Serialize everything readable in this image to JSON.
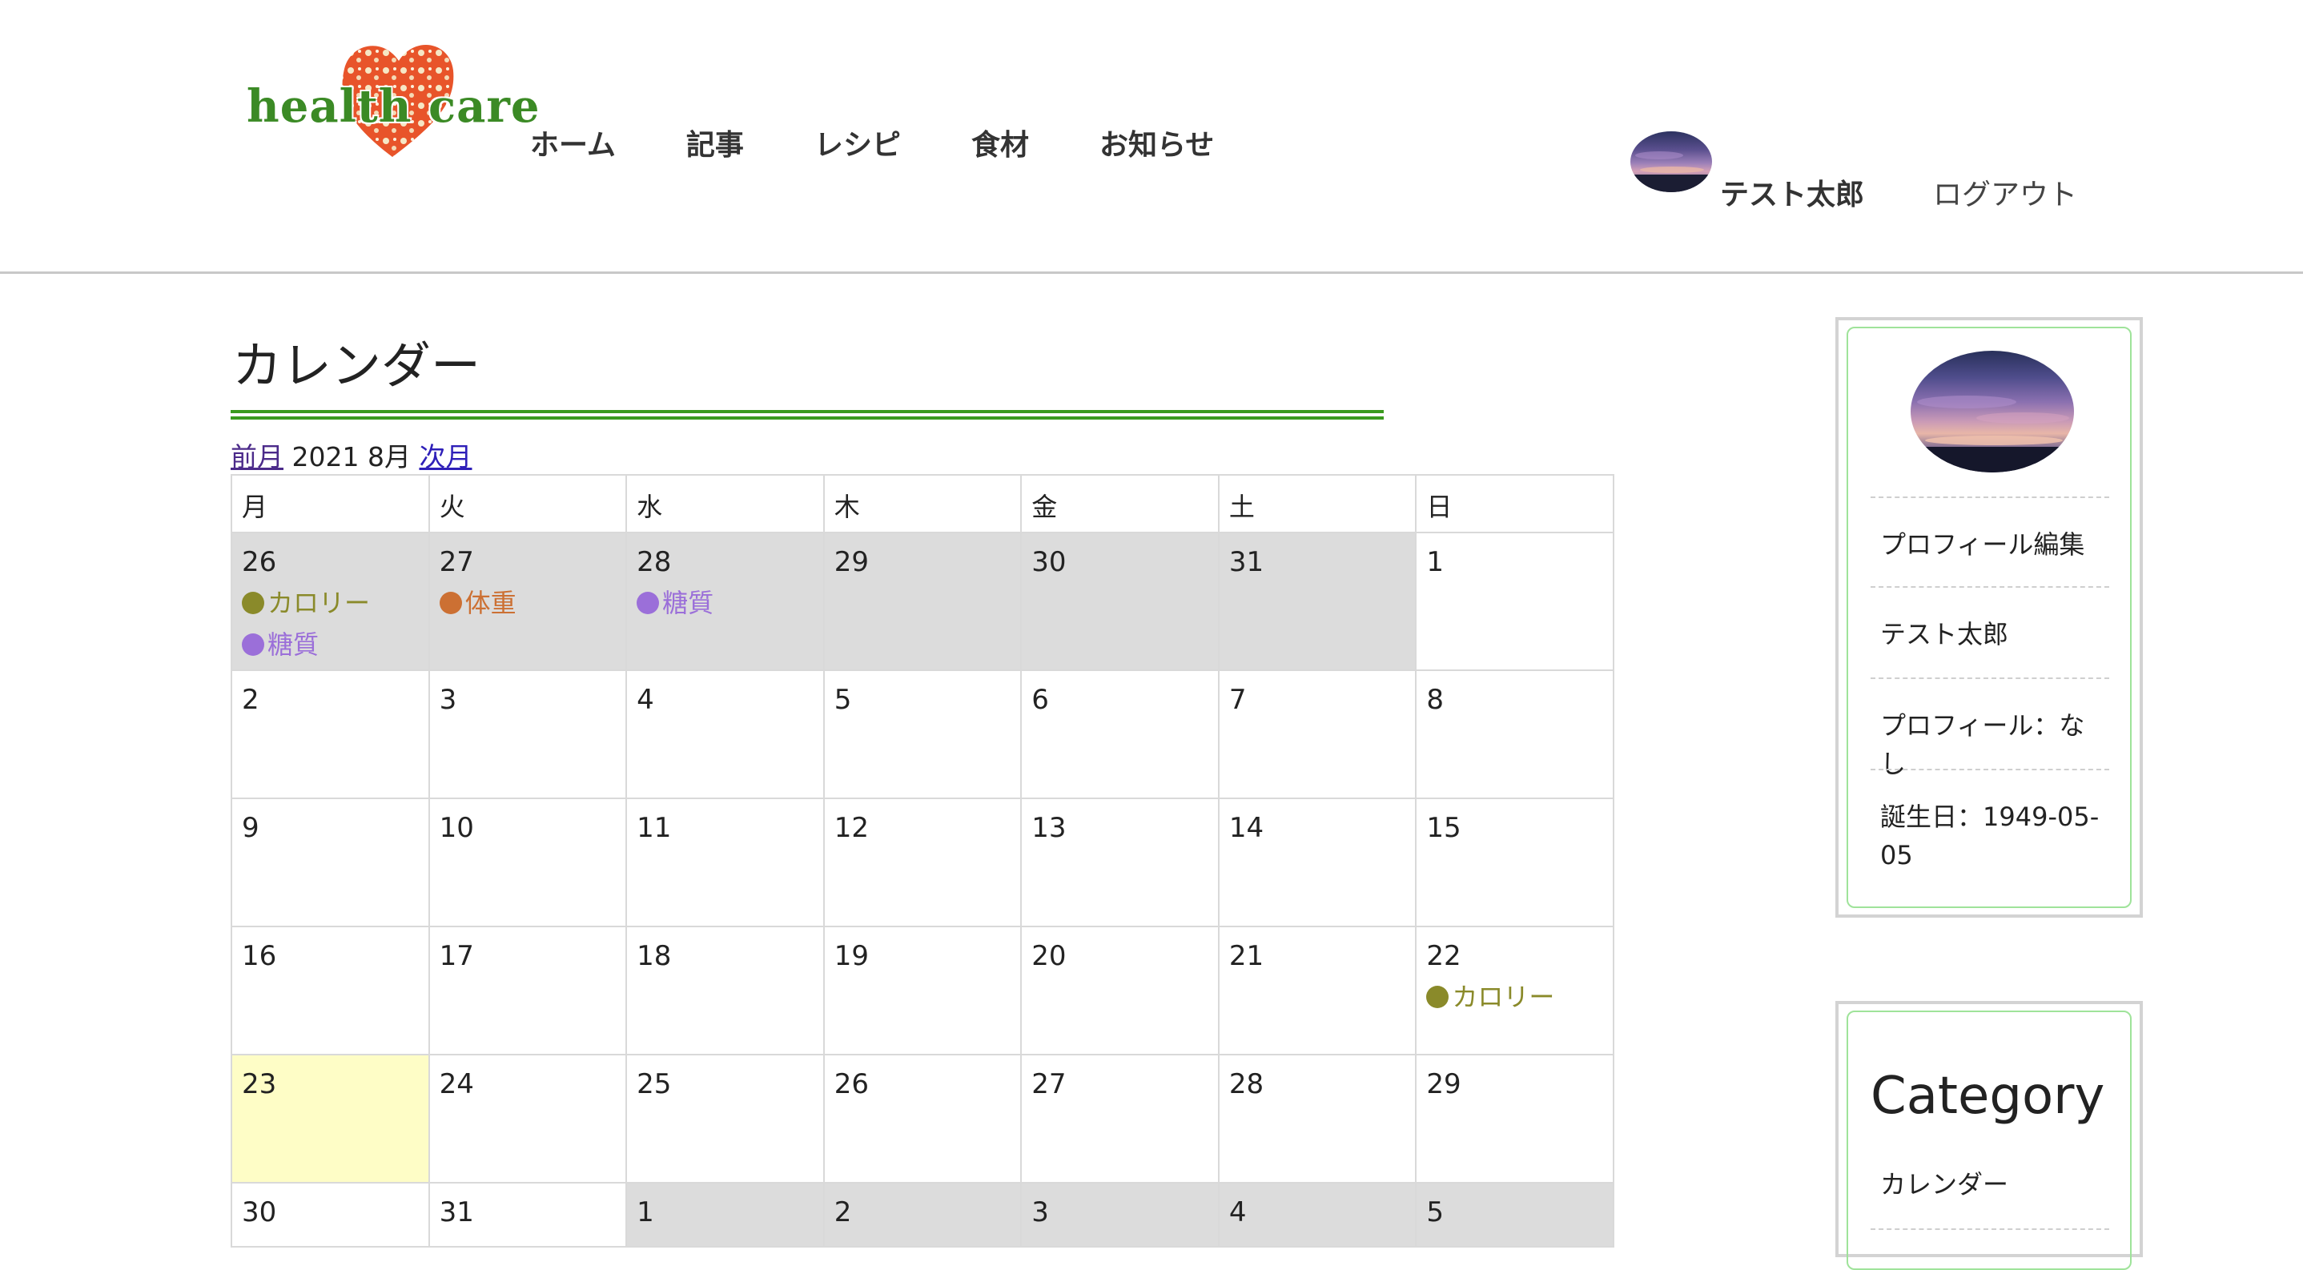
{
  "header": {
    "logo_text": "health care",
    "nav": [
      "ホーム",
      "記事",
      "レシピ",
      "食材",
      "お知らせ"
    ],
    "user_name": "テスト太郎",
    "logout": "ログアウト"
  },
  "main": {
    "title": "カレンダー",
    "prev_label": "前月",
    "current_month": "2021 8月",
    "next_label": "次月",
    "weekdays": [
      "月",
      "火",
      "水",
      "木",
      "金",
      "土",
      "日"
    ],
    "weeks": [
      [
        {
          "day": "26",
          "out": true,
          "events": [
            {
              "label": "カロリー",
              "color": "#8a8a2a"
            },
            {
              "label": "糖質",
              "color": "#9b6fd9"
            }
          ]
        },
        {
          "day": "27",
          "out": true,
          "events": [
            {
              "label": "体重",
              "color": "#cc7033"
            }
          ]
        },
        {
          "day": "28",
          "out": true,
          "events": [
            {
              "label": "糖質",
              "color": "#9b6fd9"
            }
          ]
        },
        {
          "day": "29",
          "out": true,
          "events": []
        },
        {
          "day": "30",
          "out": true,
          "events": []
        },
        {
          "day": "31",
          "out": true,
          "events": []
        },
        {
          "day": "1",
          "out": false,
          "events": []
        }
      ],
      [
        {
          "day": "2",
          "out": false,
          "events": []
        },
        {
          "day": "3",
          "out": false,
          "events": []
        },
        {
          "day": "4",
          "out": false,
          "events": []
        },
        {
          "day": "5",
          "out": false,
          "events": []
        },
        {
          "day": "6",
          "out": false,
          "events": []
        },
        {
          "day": "7",
          "out": false,
          "events": []
        },
        {
          "day": "8",
          "out": false,
          "events": []
        }
      ],
      [
        {
          "day": "9",
          "out": false,
          "events": []
        },
        {
          "day": "10",
          "out": false,
          "events": []
        },
        {
          "day": "11",
          "out": false,
          "events": []
        },
        {
          "day": "12",
          "out": false,
          "events": []
        },
        {
          "day": "13",
          "out": false,
          "events": []
        },
        {
          "day": "14",
          "out": false,
          "events": []
        },
        {
          "day": "15",
          "out": false,
          "events": []
        }
      ],
      [
        {
          "day": "16",
          "out": false,
          "events": []
        },
        {
          "day": "17",
          "out": false,
          "events": []
        },
        {
          "day": "18",
          "out": false,
          "events": []
        },
        {
          "day": "19",
          "out": false,
          "events": []
        },
        {
          "day": "20",
          "out": false,
          "events": []
        },
        {
          "day": "21",
          "out": false,
          "events": []
        },
        {
          "day": "22",
          "out": false,
          "events": [
            {
              "label": "カロリー",
              "color": "#8a8a2a"
            }
          ]
        }
      ],
      [
        {
          "day": "23",
          "out": false,
          "today": true,
          "events": []
        },
        {
          "day": "24",
          "out": false,
          "events": []
        },
        {
          "day": "25",
          "out": false,
          "events": []
        },
        {
          "day": "26",
          "out": false,
          "events": []
        },
        {
          "day": "27",
          "out": false,
          "events": []
        },
        {
          "day": "28",
          "out": false,
          "events": []
        },
        {
          "day": "29",
          "out": false,
          "events": []
        }
      ],
      [
        {
          "day": "30",
          "out": false,
          "events": []
        },
        {
          "day": "31",
          "out": false,
          "events": []
        },
        {
          "day": "1",
          "out": true,
          "events": []
        },
        {
          "day": "2",
          "out": true,
          "events": []
        },
        {
          "day": "3",
          "out": true,
          "events": []
        },
        {
          "day": "4",
          "out": true,
          "events": []
        },
        {
          "day": "5",
          "out": true,
          "events": []
        }
      ]
    ]
  },
  "sidebar": {
    "profile": {
      "edit_link": "プロフィール編集",
      "name": "テスト太郎",
      "profile_text": "プロフィール：なし",
      "birthday_text": "誕生日：1949-05-05"
    },
    "category": {
      "title": "Category",
      "links": [
        "カレンダー"
      ]
    }
  },
  "colors": {
    "accent_green": "#3a9a1e",
    "card_border_green": "#9fe39a",
    "out_of_month": "#dcdcdc",
    "today": "#fefdc6"
  },
  "icons": {
    "logo": "heart-logo-icon",
    "avatar": "sunset-avatar"
  }
}
